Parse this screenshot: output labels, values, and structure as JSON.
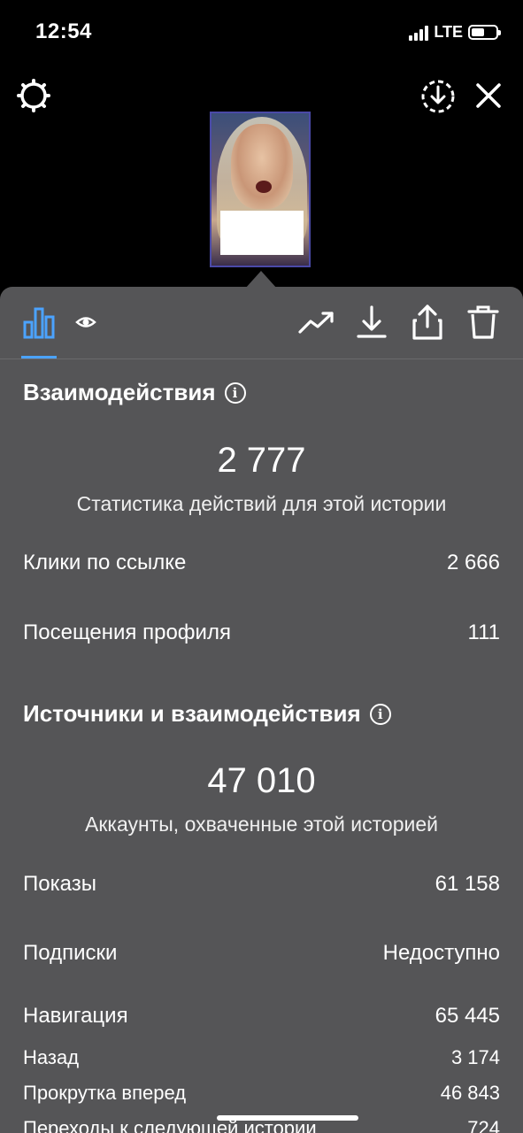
{
  "status_bar": {
    "time": "12:54",
    "network": "LTE",
    "battery_level": 0.55
  },
  "icons": {
    "settings": "gear-icon",
    "download_circle": "download-circle-icon",
    "close": "close-icon",
    "insights": "bar-chart-icon",
    "views": "eye-icon",
    "promote": "trending-up-icon",
    "download": "download-icon",
    "share": "share-icon",
    "delete": "trash-icon"
  },
  "interactions": {
    "title": "Взаимодействия",
    "total": "2 777",
    "caption": "Статистика действий для этой истории",
    "rows": [
      {
        "label": "Клики по ссылке",
        "value": "2 666"
      },
      {
        "label": "Посещения профиля",
        "value": "111"
      }
    ]
  },
  "discovery": {
    "title": "Источники и взаимодействия",
    "total": "47 010",
    "caption": "Аккаунты, охваченные этой историей",
    "rows": [
      {
        "label": "Показы",
        "value": "61 158"
      },
      {
        "label": "Подписки",
        "value": "Недоступно"
      },
      {
        "label": "Навигация",
        "value": "65 445"
      }
    ],
    "nav_rows": [
      {
        "label": "Назад",
        "value": "3 174"
      },
      {
        "label": "Прокрутка вперед",
        "value": "46 843"
      },
      {
        "label": "Переходы к следующей истории",
        "value": "724"
      }
    ]
  },
  "colors": {
    "panel": "#555557",
    "accent": "#4ba3ff"
  }
}
